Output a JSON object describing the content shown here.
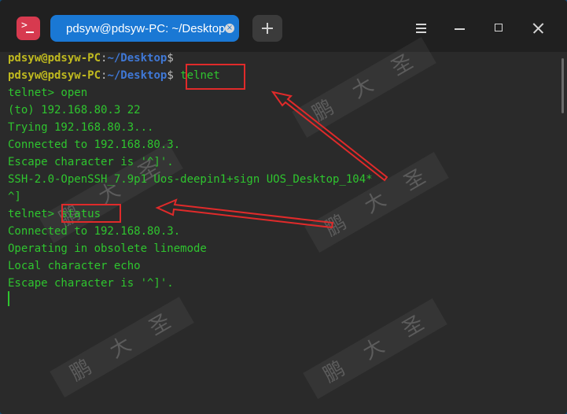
{
  "window": {
    "tab_title": "pdsyw@pdsyw-PC: ~/Desktop",
    "tab_close_glyph": "×",
    "app_icon_glyph": ">"
  },
  "terminal": {
    "prompt_user": "pdsyw@pdsyw-PC",
    "prompt_sep": ":",
    "prompt_path": "~/Desktop",
    "prompt_dollar": "$",
    "command_telnet": "telnet",
    "lines": [
      "telnet> open",
      "(to) 192.168.80.3 22",
      "Trying 192.168.80.3...",
      "Connected to 192.168.80.3.",
      "Escape character is '^]'.",
      "SSH-2.0-OpenSSH_7.9p1 Uos-deepin1+sign UOS_Desktop_104*",
      "^]"
    ],
    "status_prompt": "telnet> ",
    "status_command": "status",
    "status_lines": [
      "Connected to 192.168.80.3.",
      "Operating in obsolete linemode",
      "Local character echo",
      "Escape character is '^]'."
    ]
  },
  "watermark": {
    "chars": [
      "鹏",
      "大",
      "圣"
    ]
  },
  "colors": {
    "annotation_red": "#e02a2a",
    "text_green": "#2fc52f",
    "tab_blue": "#1a78d4"
  },
  "icons": [
    "terminal-app-icon",
    "tab-close-icon",
    "plus-icon",
    "hamburger-menu-icon",
    "minimize-icon",
    "maximize-icon",
    "close-icon"
  ]
}
